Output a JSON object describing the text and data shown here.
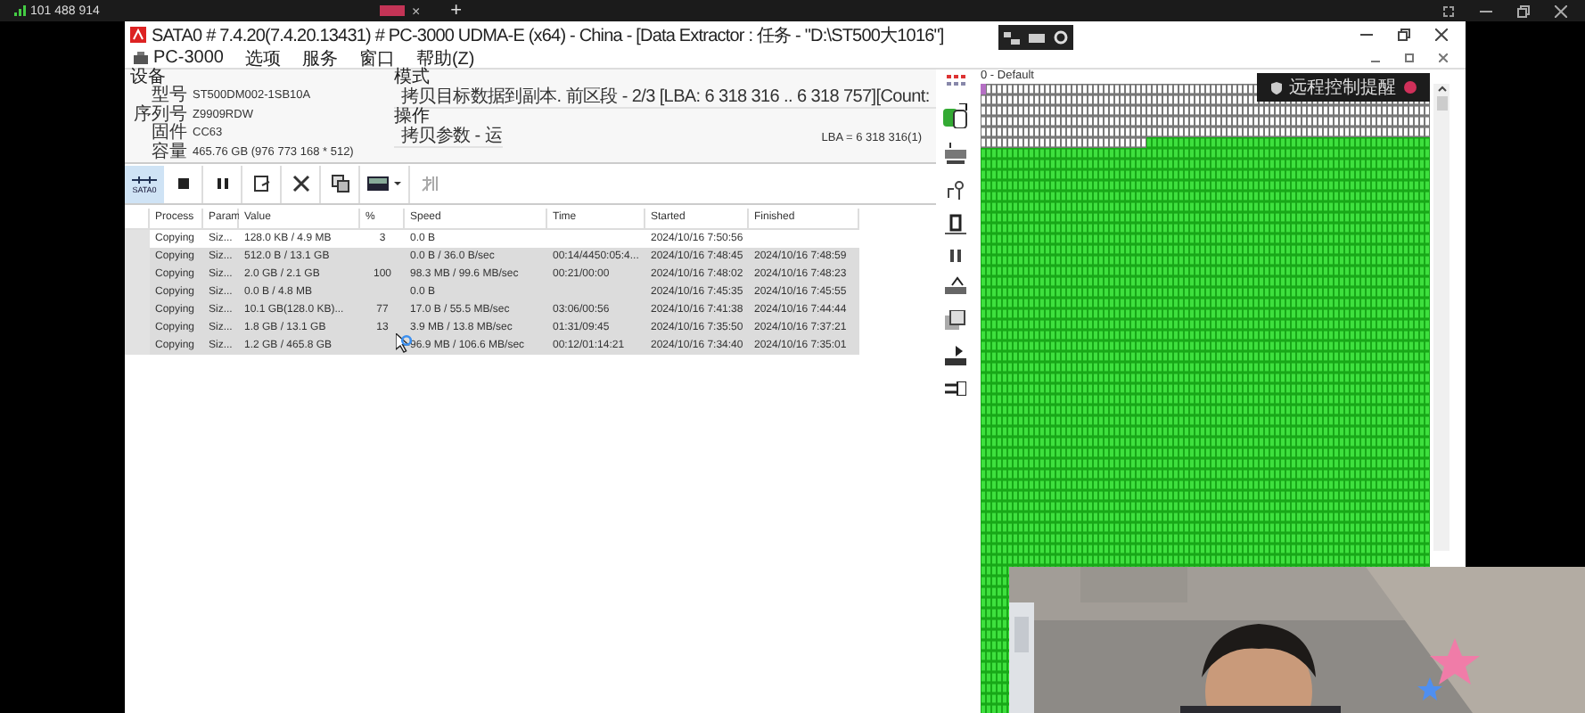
{
  "topbar": {
    "connection_id": "101 488 914",
    "tab_close": "×",
    "new_tab": "+"
  },
  "window": {
    "title": "SATA0 # 7.4.20(7.4.20.13431) # PC-3000 UDMA-E (x64) - China - [Data Extractor : 任务 - \"D:\\ST500大1016\"]"
  },
  "menu": [
    "PC-3000",
    "选项",
    "服务",
    "窗口",
    "帮助(Z)"
  ],
  "device": {
    "heading": "设备",
    "fields": [
      {
        "label": "型号",
        "value": "ST500DM002-1SB10A"
      },
      {
        "label": "序列号",
        "value": "Z9909RDW"
      },
      {
        "label": "固件",
        "value": "CC63"
      },
      {
        "label": "容量",
        "value": "465.76 GB (976 773 168 * 512)"
      }
    ]
  },
  "mode": {
    "heading": "模式",
    "value": "拷贝目标数据到副本. 前区段 - 2/3 [LBA: 6 318 316 .. 6 318 757][Count:"
  },
  "operation": {
    "heading": "操作",
    "value": "拷贝参数 - 运",
    "lba": "LBA =  6 318 316(1)"
  },
  "toolbar": {
    "port_button": "SATA0"
  },
  "table": {
    "columns": [
      "Process",
      "Param",
      "Value",
      "%",
      "Speed",
      "Time",
      "Started",
      "Finished"
    ],
    "rows": [
      {
        "process": "Copying",
        "param": "Siz...",
        "value": "128.0 KB / 4.9 MB",
        "percent": "3",
        "speed": "0.0 B",
        "started": "2024/10/16 7:50:56",
        "current": true
      },
      {
        "process": "Copying",
        "param": "Siz...",
        "value": "512.0 B / 13.1 GB",
        "speed": "0.0 B / 36.0 B/sec",
        "time": "00:14/4450:05:4...",
        "started": "2024/10/16 7:48:45",
        "finished": "2024/10/16 7:48:59",
        "current": false
      },
      {
        "process": "Copying",
        "param": "Siz...",
        "value": "2.0 GB / 2.1 GB",
        "percent": "100",
        "speed": "98.3 MB / 99.6 MB/sec",
        "time": "00:21/00:00",
        "started": "2024/10/16 7:48:02",
        "finished": "2024/10/16 7:48:23",
        "current": false
      },
      {
        "process": "Copying",
        "param": "Siz...",
        "value": "0.0 B / 4.8 MB",
        "speed": "0.0 B",
        "started": "2024/10/16 7:45:35",
        "finished": "2024/10/16 7:45:55",
        "current": false
      },
      {
        "process": "Copying",
        "param": "Siz...",
        "value": "10.1 GB(128.0 KB)...",
        "percent": "77",
        "speed": "17.0 B / 55.5 MB/sec",
        "time": "03:06/00:56",
        "started": "2024/10/16 7:41:38",
        "finished": "2024/10/16 7:44:44",
        "current": false
      },
      {
        "process": "Copying",
        "param": "Siz...",
        "value": "1.8 GB / 13.1 GB",
        "percent": "13",
        "speed": "3.9 MB / 13.8 MB/sec",
        "time": "01:31/09:45",
        "started": "2024/10/16 7:35:50",
        "finished": "2024/10/16 7:37:21",
        "current": false
      },
      {
        "process": "Copying",
        "param": "Siz...",
        "value": "1.2 GB / 465.8 GB",
        "speed": "96.9 MB / 106.6 MB/sec",
        "time": "00:12/01:14:21",
        "started": "2024/10/16 7:34:40",
        "finished": "2024/10/16 7:35:01",
        "current": false
      }
    ]
  },
  "map": {
    "title": "0 - Default"
  },
  "notification": {
    "text": "远程控制提醒"
  }
}
